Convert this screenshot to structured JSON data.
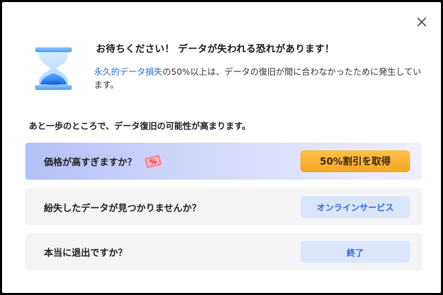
{
  "dialog": {
    "title": "お待ちください！ データが失われる恐れがあります！",
    "description_highlight": "永久的データ損失",
    "description_rest": "の50%以上は、データの復旧が間に合わなかったために発生しています。",
    "subheading": "あと一歩のところで、データ復旧の可能性が高まります。"
  },
  "options": [
    {
      "label": "価格が高すぎますか？",
      "button_label": "50%割引を取得",
      "icon": "discount-tag-icon"
    },
    {
      "label": "紛失したデータが見つかりませんか？",
      "button_label": "オンラインサービス"
    },
    {
      "label": "本当に退出ですか？",
      "button_label": "終了"
    }
  ],
  "colors": {
    "accent_blue": "#2f6bdc",
    "orange_button": "#f5a524",
    "row_gradient_start": "#b3bff7",
    "row_bg": "#f4f4f6"
  },
  "icons": {
    "close": "close-icon",
    "hero": "hourglass-icon"
  }
}
